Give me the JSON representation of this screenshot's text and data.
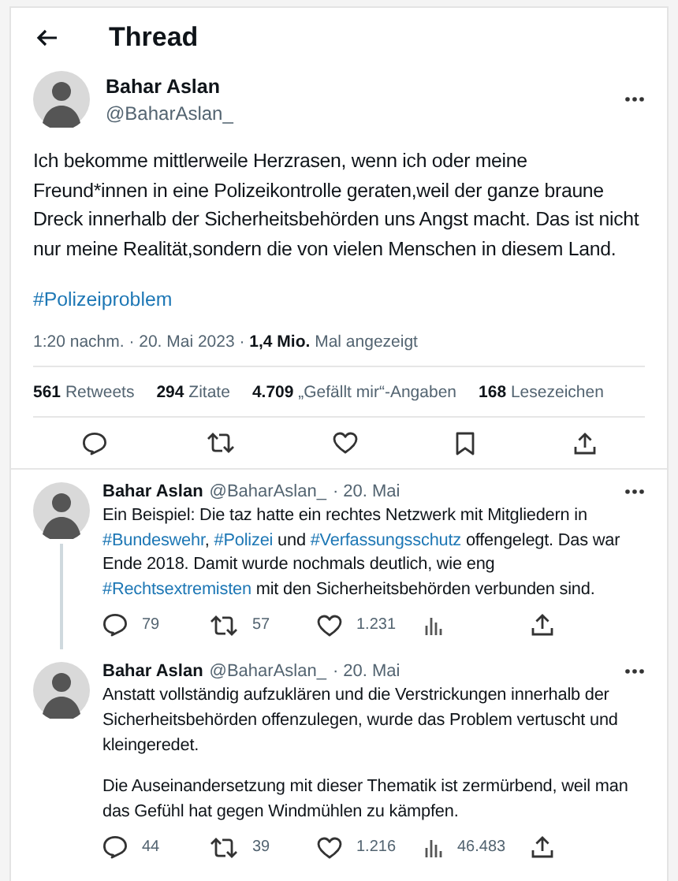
{
  "header": {
    "title": "Thread"
  },
  "tweet": {
    "name": "Bahar Aslan",
    "handle": "@BaharAslan_",
    "text": "Ich bekomme mittlerweile Herzrasen, wenn ich oder meine Freund*innen in eine Polizeikontrolle geraten,weil der ganze braune Dreck innerhalb der Sicherheitsbehörden uns Angst macht. Das ist nicht nur meine Realität,sondern die von vielen Menschen in diesem Land.",
    "hashtag": "#Polizeiproblem",
    "meta": "1:20 nachm. · 20. Mai 2023 · **1,4 Mio.** Mal angezeigt",
    "stats": [
      {
        "count": "561",
        "label": "Retweets"
      },
      {
        "count": "294",
        "label": "Zitate"
      },
      {
        "count": "4.709",
        "label": "„Gefällt mir“-Angaben"
      },
      {
        "count": "168",
        "label": "Lesezeichen"
      }
    ],
    "actions": [
      {
        "kind": "reply"
      },
      {
        "kind": "retweet"
      },
      {
        "kind": "like"
      },
      {
        "kind": "bookmark"
      },
      {
        "kind": "share"
      }
    ]
  },
  "replies": [
    {
      "name": "Bahar Aslan",
      "handle": "@BaharAslan_",
      "date": "· 20. Mai",
      "thread_line": true,
      "paragraphs": [
        [
          {
            "kind": "text",
            "text": "Ein Beispiel: Die taz hatte ein rechtes Netzwerk mit Mitgliedern in "
          },
          {
            "kind": "hashtag",
            "text": "#Bundeswehr"
          },
          {
            "kind": "text",
            "text": ", "
          },
          {
            "kind": "hashtag",
            "text": "#Polizei"
          },
          {
            "kind": "text",
            "text": " und "
          },
          {
            "kind": "hashtag",
            "text": "#Verfassungsschutz"
          },
          {
            "kind": "text",
            "text": " offengelegt. Das war Ende 2018. Damit wurde nochmals deutlich, wie eng "
          },
          {
            "kind": "hashtag",
            "text": "#Rechtsextremisten"
          },
          {
            "kind": "text",
            "text": " mit den Sicherheitsbehörden verbunden sind."
          }
        ]
      ],
      "actions": [
        {
          "kind": "reply",
          "count": "79"
        },
        {
          "kind": "retweet",
          "count": "57"
        },
        {
          "kind": "like",
          "count": "1.231"
        },
        {
          "kind": "views"
        },
        {
          "kind": "share"
        }
      ]
    },
    {
      "name": "Bahar Aslan",
      "handle": "@BaharAslan_",
      "date": "· 20. Mai",
      "thread_line": false,
      "paragraphs": [
        [
          {
            "kind": "text",
            "text": "Anstatt vollständig aufzuklären und die Verstrickungen innerhalb der Sicherheitsbehörden offenzulegen, wurde das Problem vertuscht und kleingeredet."
          }
        ],
        [
          {
            "kind": "text",
            "text": "Die Auseinandersetzung mit dieser Thematik ist zermürbend, weil man das Gefühl hat gegen Windmühlen zu kämpfen."
          }
        ]
      ],
      "actions": [
        {
          "kind": "reply",
          "count": "44"
        },
        {
          "kind": "retweet",
          "count": "39"
        },
        {
          "kind": "like",
          "count": "1.216"
        },
        {
          "kind": "views",
          "count": "46.483"
        },
        {
          "kind": "share"
        }
      ]
    }
  ]
}
